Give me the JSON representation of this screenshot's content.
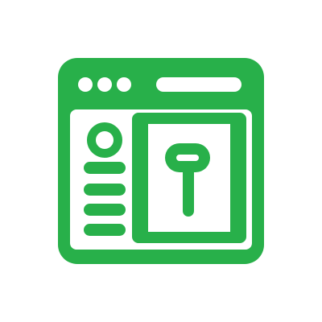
{
  "icon": {
    "name": "browser-window-with-pin-icon",
    "color": "#28B04A",
    "background": "#ffffff"
  }
}
